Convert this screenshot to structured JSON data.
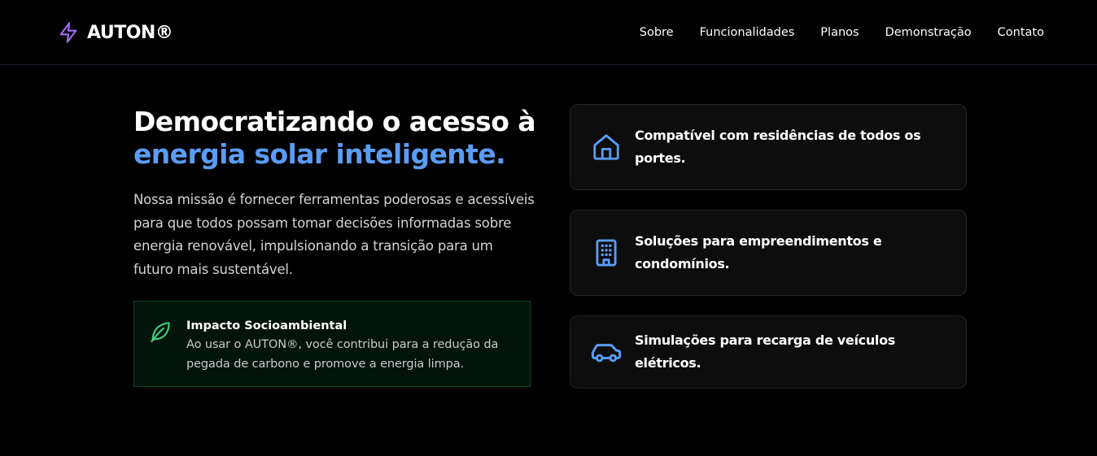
{
  "brand": {
    "name": "AUTON®",
    "icon": "lightning-bolt-icon",
    "icon_color": "#a569f0"
  },
  "nav": {
    "links": [
      "Sobre",
      "Funcionalidades",
      "Planos",
      "Demonstração",
      "Contato"
    ]
  },
  "hero": {
    "headline_line1": "Democratizando o acesso à",
    "headline_line2": "energia solar inteligente.",
    "accent_color": "#5b9cf6",
    "mission": "Nossa missão é fornecer ferramentas poderosas e acessíveis para que todos possam tomar decisões informadas sobre energia renovável, impulsionando a transição para um futuro mais sustentável."
  },
  "impact": {
    "icon": "leaf-icon",
    "icon_color": "#3fcf7a",
    "title": "Impacto Socioambiental",
    "text": "Ao usar o AUTON®, você contribui para a redução da pegada de carbono e promove a energia limpa."
  },
  "features": [
    {
      "icon": "home-icon",
      "text": "Compatível com residências de todos os portes."
    },
    {
      "icon": "building-icon",
      "text": "Soluções para empreendimentos e condomínios."
    },
    {
      "icon": "car-icon",
      "text": "Simulações para recarga de veículos elétricos."
    }
  ],
  "feature_icon_color": "#5b9cf6"
}
